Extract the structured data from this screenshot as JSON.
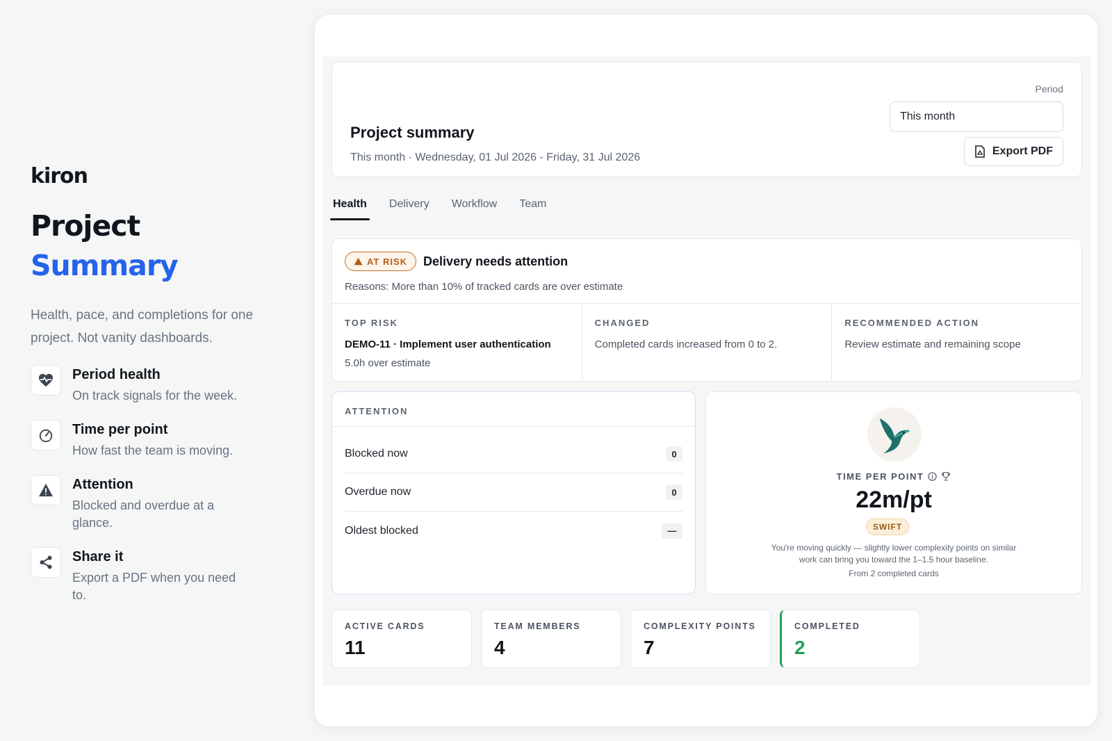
{
  "brand": "kiron",
  "hero": {
    "line1": "Project",
    "line2": "Summary"
  },
  "lead": "Health, pace, and completions for one project. Not vanity dashboards.",
  "features": [
    {
      "title": "Period health",
      "desc": "On track signals for the week.",
      "icon": "heart-pulse-icon"
    },
    {
      "title": "Time per point",
      "desc": "How fast the team is moving.",
      "icon": "gauge-icon"
    },
    {
      "title": "Attention",
      "desc": "Blocked and overdue at a glance.",
      "icon": "warning-icon"
    },
    {
      "title": "Share it",
      "desc": "Export a PDF when you need to.",
      "icon": "share-icon"
    }
  ],
  "header": {
    "title": "Project summary",
    "subtitle": "This month · Wednesday, 01 Jul 2026 - Friday, 31 Jul 2026",
    "period_label": "Period",
    "period_value": "This month",
    "export_label": "Export PDF"
  },
  "tabs": [
    "Health",
    "Delivery",
    "Workflow",
    "Team"
  ],
  "active_tab": "Health",
  "risk": {
    "badge": "AT RISK",
    "title": "Delivery needs attention",
    "reason": "Reasons: More than 10% of tracked cards are over estimate",
    "top_risk_label": "TOP RISK",
    "top_risk_value": "DEMO-11 · Implement user authentication",
    "top_risk_detail": "5.0h over estimate",
    "changed_label": "CHANGED",
    "changed_value": "Completed cards increased from 0 to 2.",
    "action_label": "RECOMMENDED ACTION",
    "action_value": "Review estimate and remaining scope"
  },
  "attention": {
    "label": "ATTENTION",
    "rows": [
      {
        "label": "Blocked now",
        "value": "0"
      },
      {
        "label": "Overdue now",
        "value": "0"
      },
      {
        "label": "Oldest blocked",
        "value": "—"
      }
    ]
  },
  "tpp": {
    "label": "TIME PER POINT",
    "value": "22m/pt",
    "badge": "SWIFT",
    "desc": "You're moving quickly — slightly lower complexity points on similar work can bring you toward the 1–1.5 hour baseline.",
    "from": "From 2 completed cards"
  },
  "stats": [
    {
      "label": "ACTIVE CARDS",
      "value": "11"
    },
    {
      "label": "TEAM MEMBERS",
      "value": "4"
    },
    {
      "label": "COMPLEXITY POINTS",
      "value": "7"
    },
    {
      "label": "COMPLETED",
      "value": "2"
    }
  ],
  "colors": {
    "accent": "#2563eb",
    "risk": "#b45f16",
    "success": "#22a05a",
    "bird": "#1f6f6b"
  }
}
